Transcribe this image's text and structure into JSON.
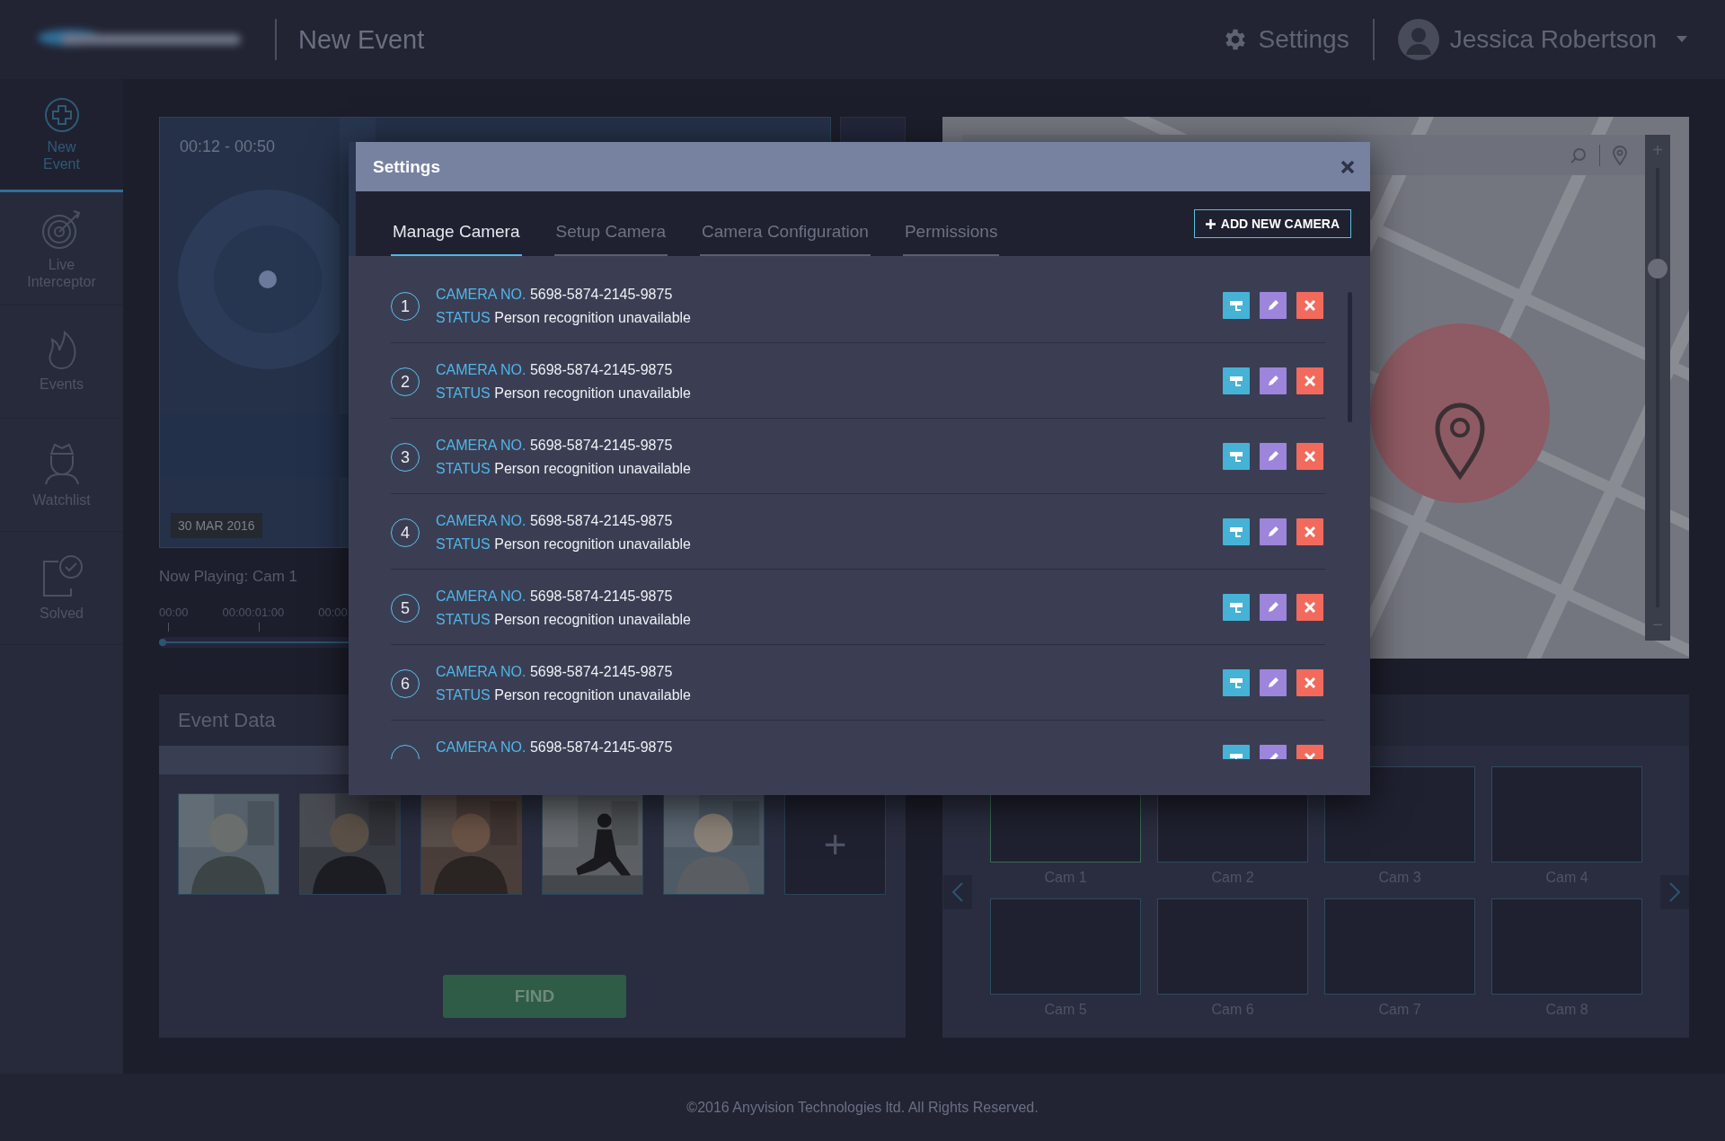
{
  "header": {
    "title": "New Event",
    "settings_link": "Settings",
    "user_name": "Jessica Robertson"
  },
  "sidebar": {
    "items": [
      {
        "label": "New Event",
        "kind": "new-event",
        "selected": true
      },
      {
        "label": "Live Interceptor",
        "kind": "live",
        "selected": false
      },
      {
        "label": "Events",
        "kind": "events",
        "selected": false
      },
      {
        "label": "Watchlist",
        "kind": "watchlist",
        "selected": false
      },
      {
        "label": "Solved",
        "kind": "solved",
        "selected": false
      }
    ]
  },
  "video": {
    "time_range": "00:12 - 00:50",
    "date": "30 MAR 2016",
    "now_playing": "Now Playing: Cam 1",
    "timeline_labels": [
      "00:00",
      "00:00:01:00",
      "00:00"
    ],
    "progress": {
      "level": 0
    }
  },
  "event_data": {
    "title": "Event Data",
    "add_button": "+",
    "find_button": "FIND"
  },
  "map": {
    "zoom": {
      "plus": "+",
      "minus": "−",
      "level": 0.77
    }
  },
  "cameras_grid": {
    "tiles": [
      {
        "label": "Cam 1",
        "selected": true
      },
      {
        "label": "Cam 2",
        "selected": false
      },
      {
        "label": "Cam 3",
        "selected": false
      },
      {
        "label": "Cam 4",
        "selected": false
      },
      {
        "label": "Cam 5",
        "selected": false
      },
      {
        "label": "Cam 6",
        "selected": false
      },
      {
        "label": "Cam 7",
        "selected": false
      },
      {
        "label": "Cam 8",
        "selected": false
      }
    ]
  },
  "modal": {
    "title": "Settings",
    "tabs": [
      {
        "label": "Manage Camera",
        "selected": true
      },
      {
        "label": "Setup Camera",
        "selected": false
      },
      {
        "label": "Camera Configuration",
        "selected": false
      },
      {
        "label": "Permissions",
        "selected": false
      }
    ],
    "add_button": "ADD NEW CAMERA",
    "rows": [
      {
        "number": "1",
        "camera_label": "CAMERA NO.",
        "camera_no": "5698-5874-2145-9875",
        "status_label": "STATUS",
        "status": "Person recognition unavailable"
      },
      {
        "number": "2",
        "camera_label": "CAMERA NO.",
        "camera_no": "5698-5874-2145-9875",
        "status_label": "STATUS",
        "status": "Person recognition unavailable"
      },
      {
        "number": "3",
        "camera_label": "CAMERA NO.",
        "camera_no": "5698-5874-2145-9875",
        "status_label": "STATUS",
        "status": "Person recognition unavailable"
      },
      {
        "number": "4",
        "camera_label": "CAMERA NO.",
        "camera_no": "5698-5874-2145-9875",
        "status_label": "STATUS",
        "status": "Person recognition unavailable"
      },
      {
        "number": "5",
        "camera_label": "CAMERA NO.",
        "camera_no": "5698-5874-2145-9875",
        "status_label": "STATUS",
        "status": "Person recognition unavailable"
      },
      {
        "number": "6",
        "camera_label": "CAMERA NO.",
        "camera_no": "5698-5874-2145-9875",
        "status_label": "STATUS",
        "status": "Person recognition unavailable"
      },
      {
        "camera_label": "CAMERA NO.",
        "camera_no": "5698-5874-2145-9875"
      }
    ]
  },
  "footer": "©2016 Anyvision Technologies ltd. All Rights Reserved."
}
